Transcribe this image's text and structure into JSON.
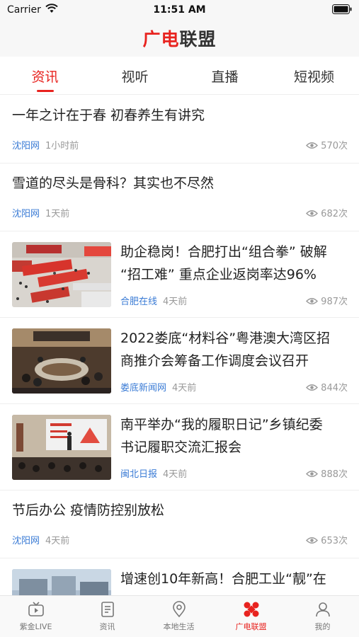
{
  "status_bar": {
    "carrier": "Carrier",
    "time": "11:51 AM"
  },
  "header": {
    "logo_part1": "广",
    "logo_part2": "电",
    "logo_part3": "联盟"
  },
  "tabs": [
    {
      "label": "资讯",
      "active": true
    },
    {
      "label": "视听",
      "active": false
    },
    {
      "label": "直播",
      "active": false
    },
    {
      "label": "短视频",
      "active": false
    }
  ],
  "feed": [
    {
      "title": "一年之计在于春 初春养生有讲究",
      "source": "沈阳网",
      "time": "1小时前",
      "views": "570次",
      "has_image": false
    },
    {
      "title": "雪道的尽头是骨科？其实也不尽然",
      "source": "沈阳网",
      "time": "1天前",
      "views": "682次",
      "has_image": false
    },
    {
      "title_line1": "助企稳岗！合肥打出“组合拳” 破解",
      "title_line2": "“招工难” 重点企业返岗率达96%",
      "source": "合肥在线",
      "time": "4天前",
      "views": "987次",
      "has_image": true,
      "image": "job-fair-photo"
    },
    {
      "title_line1": "2022娄底“材料谷”粤港澳大湾区招",
      "title_line2": "商推介会筹备工作调度会议召开",
      "source": "娄底新闻网",
      "time": "4天前",
      "views": "844次",
      "has_image": true,
      "image": "conference-meeting-photo"
    },
    {
      "title_line1": "南平举办“我的履职日记”乡镇纪委",
      "title_line2": "书记履职交流汇报会",
      "source": "闽北日报",
      "time": "4天前",
      "views": "888次",
      "has_image": true,
      "image": "presentation-photo"
    },
    {
      "title": "节后办公 疫情防控别放松",
      "source": "沈阳网",
      "time": "4天前",
      "views": "653次",
      "has_image": false
    },
    {
      "title_line1": "增速创10年新高！合肥工业“靓”在",
      "has_image": true,
      "image": "factory-photo"
    }
  ],
  "tabbar": [
    {
      "label": "紫金LIVE",
      "icon": "tv-icon",
      "active": false
    },
    {
      "label": "资讯",
      "icon": "document-icon",
      "active": false
    },
    {
      "label": "本地生活",
      "icon": "location-icon",
      "active": false
    },
    {
      "label": "广电联盟",
      "icon": "alliance-icon",
      "active": true
    },
    {
      "label": "我的",
      "icon": "user-icon",
      "active": false
    }
  ],
  "colors": {
    "accent": "#e8231f",
    "source_link": "#3a7bd5",
    "meta": "#999999"
  }
}
